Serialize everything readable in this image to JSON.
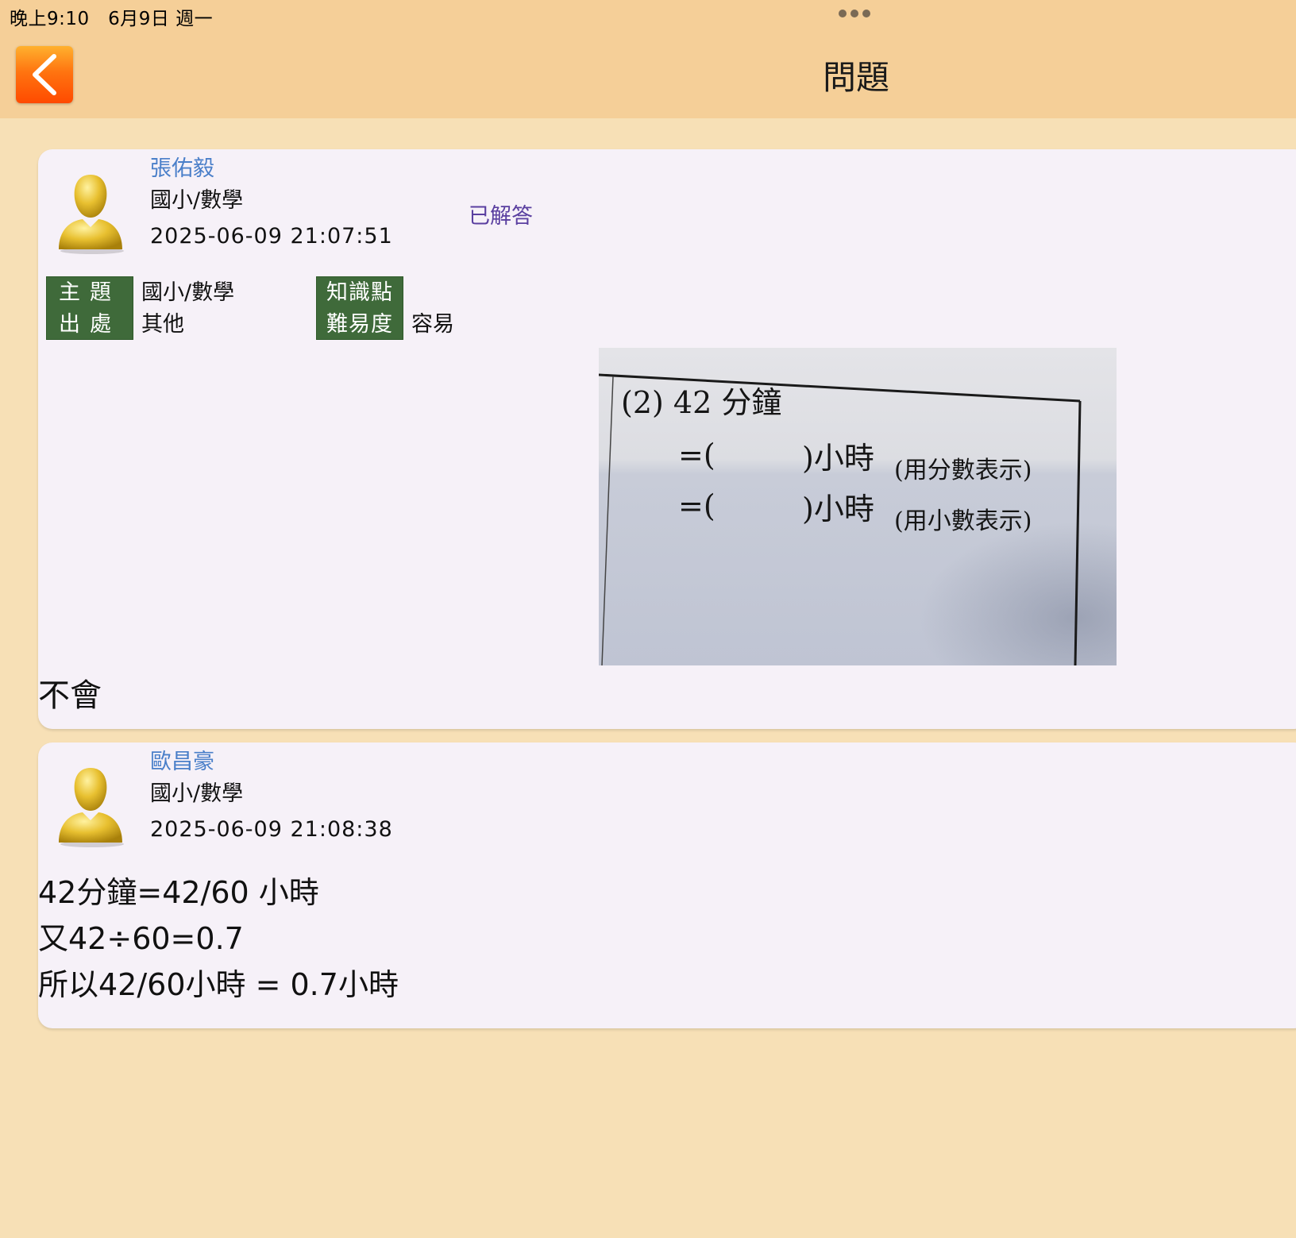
{
  "status_bar": {
    "time": "晚上9:10   6月9日 週一"
  },
  "header": {
    "title": "問題"
  },
  "question": {
    "author": "張佑毅",
    "subject": "國小/數學",
    "timestamp": "2025-06-09 21:07:51",
    "status": "已解答",
    "tags": {
      "topic_label": "主題",
      "topic_value": "國小/數學",
      "source_label": "出處",
      "source_value": "其他",
      "knowledge_label": "知識點",
      "knowledge_value": "",
      "difficulty_label": "難易度",
      "difficulty_value": "容易"
    },
    "photo": {
      "line1": "(2)  42 分鐘",
      "line2_prefix": "=(",
      "line2_suffix": ")小時",
      "line2_note": "(用分數表示)",
      "line3_prefix": "=(",
      "line3_suffix": ")小時",
      "line3_note": "(用小數表示)"
    },
    "text": "不會"
  },
  "answer": {
    "author": "歐昌豪",
    "subject": "國小/數學",
    "timestamp": "2025-06-09 21:08:38",
    "lines": [
      "42分鐘=42/60 小時",
      "又42÷60=0.7",
      "所以42/60小時 = 0.7小時"
    ]
  },
  "colors": {
    "background": "#f7e0b6",
    "header": "#f5cf98",
    "card": "#f6f1f8",
    "author": "#4a7fc9",
    "status": "#5a3fa0",
    "tag": "#3f6a3a",
    "back_button": "#ff6a10"
  }
}
